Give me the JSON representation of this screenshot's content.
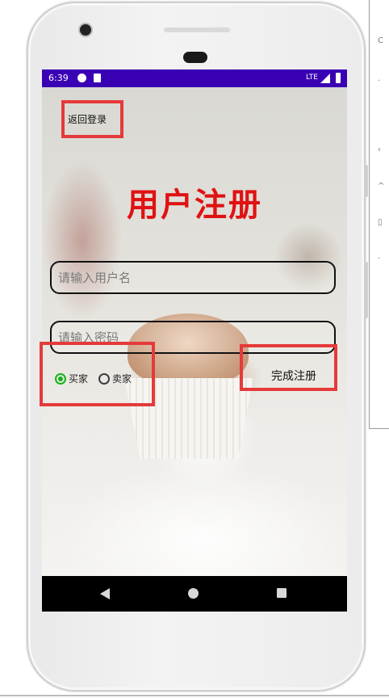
{
  "status_bar": {
    "time": "6:39",
    "network": "LTE"
  },
  "app": {
    "back_login_label": "返回登录",
    "title": "用户注册",
    "username": {
      "placeholder": "请输入用户名",
      "value": ""
    },
    "password": {
      "placeholder": "请输入密码",
      "value": ""
    },
    "role_options": [
      {
        "label": "买家",
        "checked": true
      },
      {
        "label": "卖家",
        "checked": false
      }
    ],
    "finish_label": "完成注册"
  },
  "colors": {
    "title": "#e01212",
    "status_bar": "#3a00b4",
    "radio_checked": "#18b218",
    "highlight": "#e53a3a"
  },
  "icons": [
    "back-triangle-icon",
    "home-circle-icon",
    "recent-apps-square-icon",
    "signal-icon",
    "battery-icon"
  ]
}
